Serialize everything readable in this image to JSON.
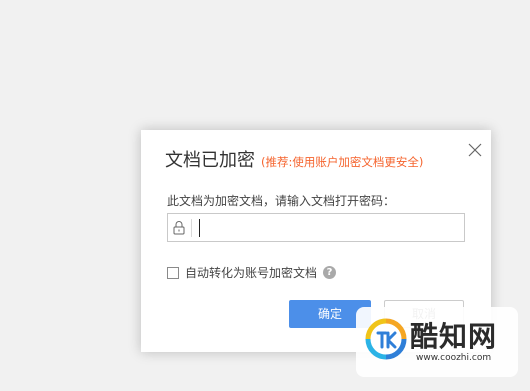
{
  "dialog": {
    "title": "文档已加密",
    "hint": "(推荐:使用账户加密文档更安全)",
    "prompt": "此文档为加密文档，请输入文档打开密码：",
    "password_value": "",
    "auto_convert_label": "自动转化为账号加密文档",
    "auto_convert_checked": false,
    "help_symbol": "?",
    "ok_label": "确定",
    "cancel_label": "取消"
  },
  "icons": [
    "close-icon",
    "lock-icon",
    "help-icon"
  ],
  "colors": {
    "hint": "#f5642e",
    "primary_button": "#4c8fe9",
    "background": "#f1f1f1"
  },
  "watermark": {
    "name": "酷知网",
    "url": "www.coozhi.com"
  }
}
